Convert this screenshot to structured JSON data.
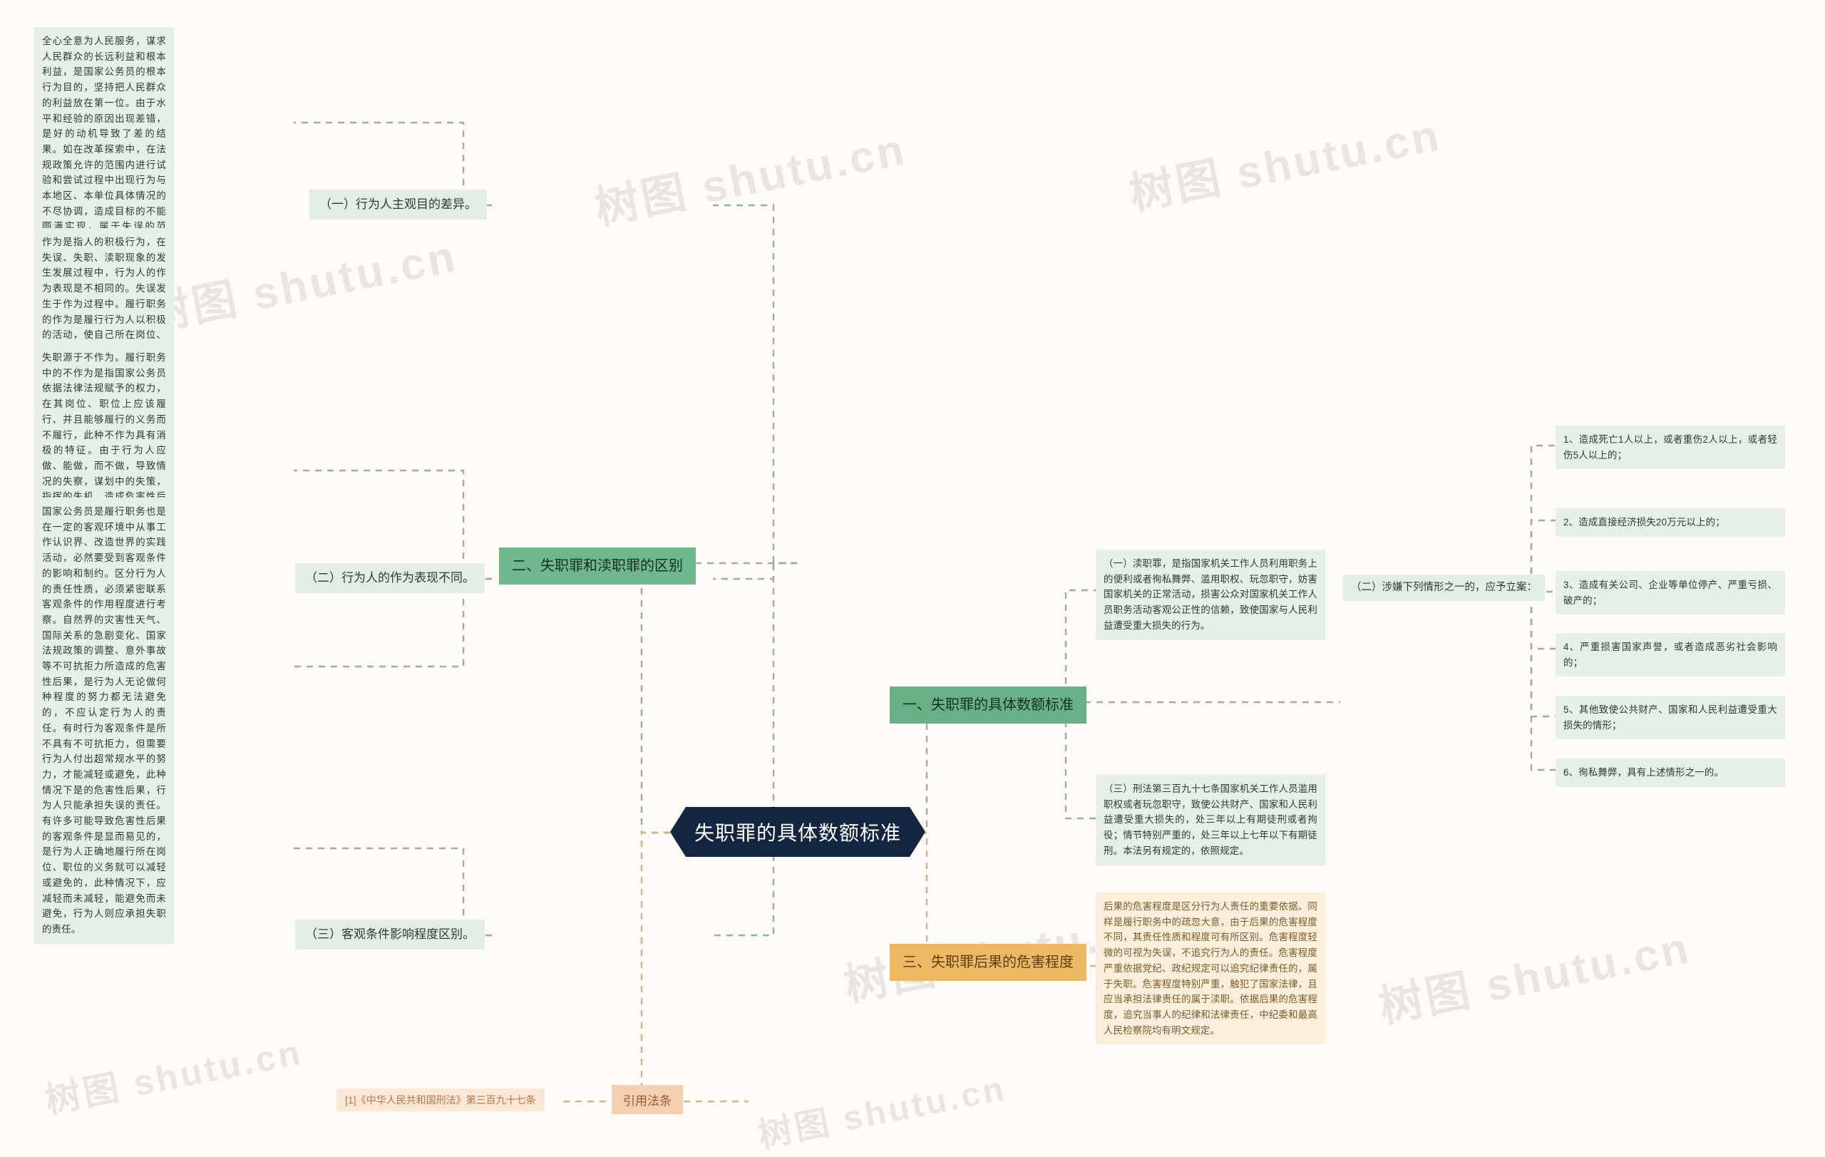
{
  "root": {
    "label": "失职罪的具体数额标准"
  },
  "watermarks": [
    "树图 shutu.cn",
    "树图 shutu.cn",
    "树图 shutu.cn",
    "树图 shutu.cn",
    "树图 shutu.cn",
    "树图 shutu.cn",
    "树图 shutu.cn"
  ],
  "branches": {
    "b1": {
      "label": "一、失职罪的具体数额标准"
    },
    "b2": {
      "label": "二、失职罪和渎职罪的区别"
    },
    "b3": {
      "label": "三、失职罪后果的危害程度"
    }
  },
  "b2_children": {
    "c1": {
      "label": "（一）行为人主观目的差异。"
    },
    "c2": {
      "label": "（二）行为人的作为表现不同。"
    },
    "c3": {
      "label": "（三）客观条件影响程度区别。"
    }
  },
  "b2_leaves": {
    "l1": "全心全意为人民服务，谋求人民群众的长远利益和根本利益，是国家公务员的根本行为目的，坚持把人民群众的利益放在第一位。由于水平和经验的原因出现差错，是好的动机导致了差的结果。如在改革探索中，在法规政策允许的范围内进行试验和尝试过程中出现行为与本地区、本单位具体情况的不尽协调，造成目标的不能圆满实现，属于失误的范畴。国家公务员的行为目的时常常会受到各种因素的干扰而发生动摇或偏离。这种动摇或偏离，为失职提供了思想基础。把地方利益、局部利益、小集团利益放在第一位，置整体的、全局的、长远的利益于不顾，在行为目的上就违背了其所在岗位、职位的要求。由此导致危害性后果，是差的动机支配下产生差的效果，属于错误地运用权力履行义务的失职行为。把私人利益放在第一位，在履行职务中，为谋求自己和亲友的私利而侵蚀国家、集体和人民群众的利益，其行为目的为其岗位、职位的要求来呈对立状态。在些种目的支配下，发生权钱交易、滥用职权、徇私枉法行为，是对国家公务员身份的亵渎，是坏的动机导致坏的结果，属于渎职性质。",
    "l2": "作为是指人的积极行为，在失误、失职、渎职现象的发生发展过程中，行为人的作为表现是不相同的。失误发生于作为过程中。履行职务的作为是履行行为人以积极的活动，使自己所在岗位、职位的工作目标得以实现，义务得以履行的行为。这种作为具有积极的特征，是实现工作目标、履行义务的积极行为。作为不等于成功，在履行职务的作为过程中，由于各种主客观条件的影响，导致调查、计划、决策、执行中的不适当、不周密，造成损失或影响，是积极履行职务中的失误。",
    "l3": "失职源于不作为。履行职务中的不作为是指国家公务员依据法律法规赋予的权力，在其岗位、职位上应该履行、并且能够履行的义务而不履行，此种不作为具有消极的特征。由于行为人应做、能做，而不做，导致情况的失察，谋划中的失策，指挥的失机，造成危害性后果，是严重不负责任情况下的失职。渎职是与其履行职务行为相悖的作为。处于一定岗位、职位的国家公务员，必须履行相应的法定义务。行为人超越了法规政策的规定，产生与其必须遵守的法规政策相冲突的行为，就是做了公务员不应做、不允许做的事，是与其应履行义务相悖方向的作为。由此而导致对管理社会、发展经济的破坏、干扰和消极影响，产生危害性后果，是逆向作为的渎职。",
    "l4": "国家公务员是履行职务也是在一定的客观环境中从事工作认识界、改造世界的实践活动，必然要受到客观条件的影响和制约。区分行为人的责任性质，必须紧密联系客观条件的作用程度进行考察。自然界的灾害性天气、国际关系的急剧变化、国家法规政策的调整、意外事故等不可抗拒力所造成的危害性后果，是行为人无论做何种程度的努力都无法避免的，不应认定行为人的责任。有时行为客观条件是所不具有不可抗拒力，但需要行为人付出超常规水平的努力，才能减轻或避免，此种情况下是的危害性后果，行为人只能承担失误的责任。有许多可能导致危害性后果的客观条件是显而易见的，是行为人正确地履行所在岗位、职位的义务就可以减轻或避免的，此种情况下，应减轻而未减轻，能避免而未避免，行为人则应承担失职的责任。"
  },
  "b1_children": {
    "c1": {
      "label": "（一）渎职罪，是指国家机关工作人员利用职务上的便利或者徇私舞弊、滥用职权、玩忽职守，妨害国家机关的正常活动，损害公众对国家机关工作人员职务活动客观公正性的信赖，致使国家与人民利益遭受重大损失的行为。"
    },
    "c2": {
      "label": "（二）涉嫌下列情形之一的，应予立案："
    },
    "c3": {
      "label": "（三）刑法第三百九十七条国家机关工作人员滥用职权或者玩忽职守，致使公共财产、国家和人民利益遭受重大损失的，处三年以上有期徒刑或者拘役；情节特别严重的，处三年以上七年以下有期徒刑。本法另有规定的，依照规定。"
    }
  },
  "b1_case_items": [
    "1、造成死亡1人以上，或者重伤2人以上，或者轻伤5人以上的；",
    "2、造成直接经济损失20万元以上的；",
    "3、造成有关公司、企业等单位停产、严重亏损、破产的；",
    "4、严重损害国家声誉，或者造成恶劣社会影响的；",
    "5、其他致使公共财产、国家和人民利益遭受重大损失的情形；",
    "6、徇私舞弊，具有上述情形之一的。"
  ],
  "b3_leaf": "后果的危害程度是区分行为人责任的重要依据。同样是履行职务中的疏忽大意，由于后果的危害程度不同，其责任性质和程度可有所区别。危害程度轻微的可视为失误，不追究行为人的责任。危害程度严重依据党纪、政纪规定可以追究纪律责任的，属于失职。危害程度特别严重，触犯了国家法律，且应当承担法律责任的属于渎职。依据后果的危害程度，追究当事人的纪律和法律责任，中纪委和最高人民检察院均有明文规定。",
  "footer": {
    "citation": "[1]《中华人民共和国刑法》第三百九十七条",
    "chip": "引用法条"
  },
  "colors": {
    "root_bg": "#14253f",
    "leaf_bg": "#e7f0e8",
    "chip_bg": "#e2eee4",
    "branch_green": "#6fb68b",
    "branch_orange": "#eeb865",
    "warm_leaf": "#fbeedb",
    "page_bg": "#fdfaf8",
    "wire": "#9aaf9f",
    "wire_warm": "#d9b284"
  }
}
